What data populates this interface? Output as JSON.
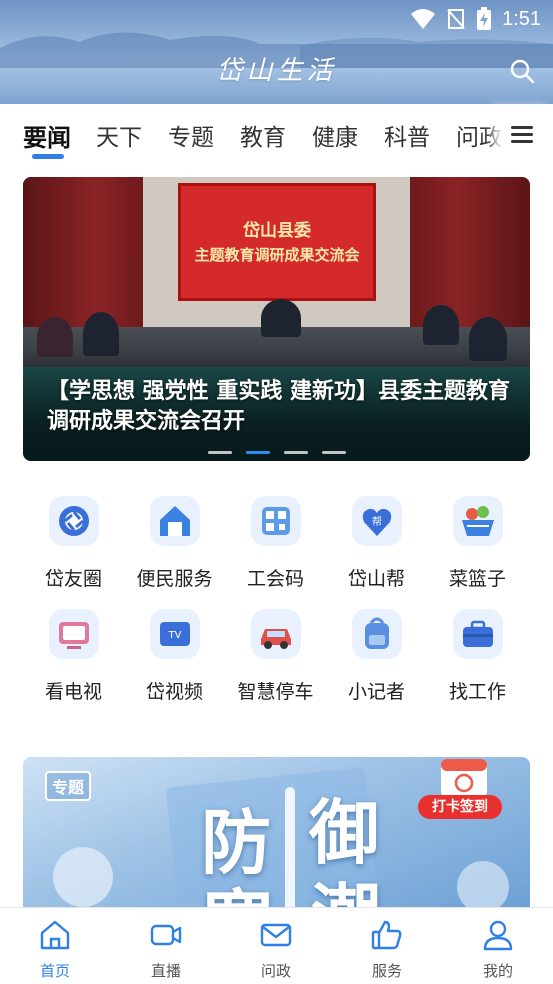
{
  "status_bar": {
    "time": "1:51"
  },
  "header": {
    "app_title": "岱山生活"
  },
  "tabs": [
    {
      "label": "要闻",
      "active": true
    },
    {
      "label": "天下"
    },
    {
      "label": "专题"
    },
    {
      "label": "教育"
    },
    {
      "label": "健康"
    },
    {
      "label": "科普"
    },
    {
      "label": "问政"
    }
  ],
  "banner": {
    "screen_line1": "岱山县委",
    "screen_line2": "主题教育调研成果交流会",
    "caption": "【学思想 强党性 重实践 建新功】县委主题教育调研成果交流会召开",
    "slide_count": 4,
    "active_slide": 2
  },
  "services": [
    {
      "label": "岱友圈",
      "icon": "camera-shutter-icon"
    },
    {
      "label": "便民服务",
      "icon": "house-icon"
    },
    {
      "label": "工会码",
      "icon": "qr-code-icon"
    },
    {
      "label": "岱山帮",
      "icon": "heart-help-icon"
    },
    {
      "label": "菜篮子",
      "icon": "vegetable-basket-icon"
    },
    {
      "label": "看电视",
      "icon": "television-icon"
    },
    {
      "label": "岱视频",
      "icon": "tv-video-icon"
    },
    {
      "label": "智慧停车",
      "icon": "car-icon"
    },
    {
      "label": "小记者",
      "icon": "backpack-icon"
    },
    {
      "label": "找工作",
      "icon": "briefcase-icon"
    }
  ],
  "promo": {
    "tag": "专题",
    "big_text_1": "防",
    "big_text_2": "御",
    "big_text_3": "寒",
    "big_text_4": "潮",
    "checkin_label": "打卡签到"
  },
  "bottom_nav": [
    {
      "label": "首页",
      "active": true
    },
    {
      "label": "直播"
    },
    {
      "label": "问政"
    },
    {
      "label": "服务"
    },
    {
      "label": "我的"
    }
  ],
  "colors": {
    "accent": "#2f7fe6",
    "header": "#7ea3cf"
  }
}
